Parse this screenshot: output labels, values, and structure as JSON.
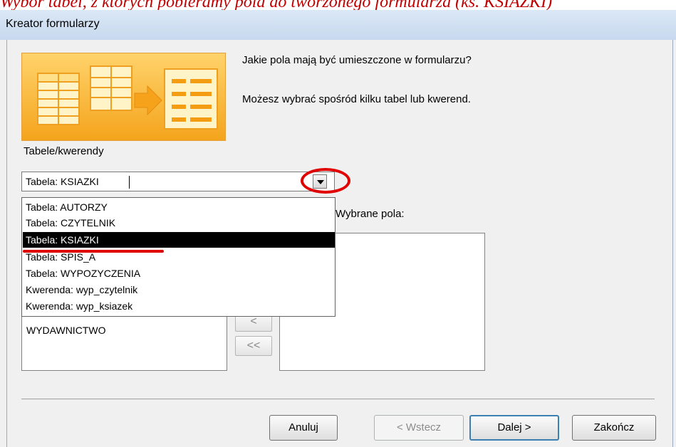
{
  "top_note": "Wybór tabel, z których pobieramy pola do tworzonego formularza (ks. KSIAZKI)",
  "window": {
    "title": "Kreator formularzy"
  },
  "wizard": {
    "question": "Jakie pola mają być umieszczone w formularzu?",
    "hint": "Możesz wybrać spośród kilku tabel lub kwerend."
  },
  "tables": {
    "label": "Tabele/kwerendy",
    "selected_value": "Tabela: KSIAZKI",
    "options": [
      "Tabela: AUTORZY",
      "Tabela: CZYTELNIK",
      "Tabela: KSIAZKI",
      "Tabela: SPIS_A",
      "Tabela: WYPOZYCZENIA",
      "Kwerenda: wyp_czytelnik",
      "Kwerenda: wyp_ksiazek"
    ]
  },
  "fields": {
    "selected_label": "Wybrane pola:",
    "available": [
      "WYDAWNICTWO"
    ]
  },
  "move_buttons": {
    "remove_one": "<",
    "remove_all": "<<"
  },
  "buttons": {
    "cancel": "Anuluj",
    "back": "< Wstecz",
    "next": "Dalej >",
    "finish": "Zakończ"
  },
  "colors": {
    "annotation": "#e10000",
    "title_bar": "#c7d9ee",
    "selected_item": "#000000"
  }
}
